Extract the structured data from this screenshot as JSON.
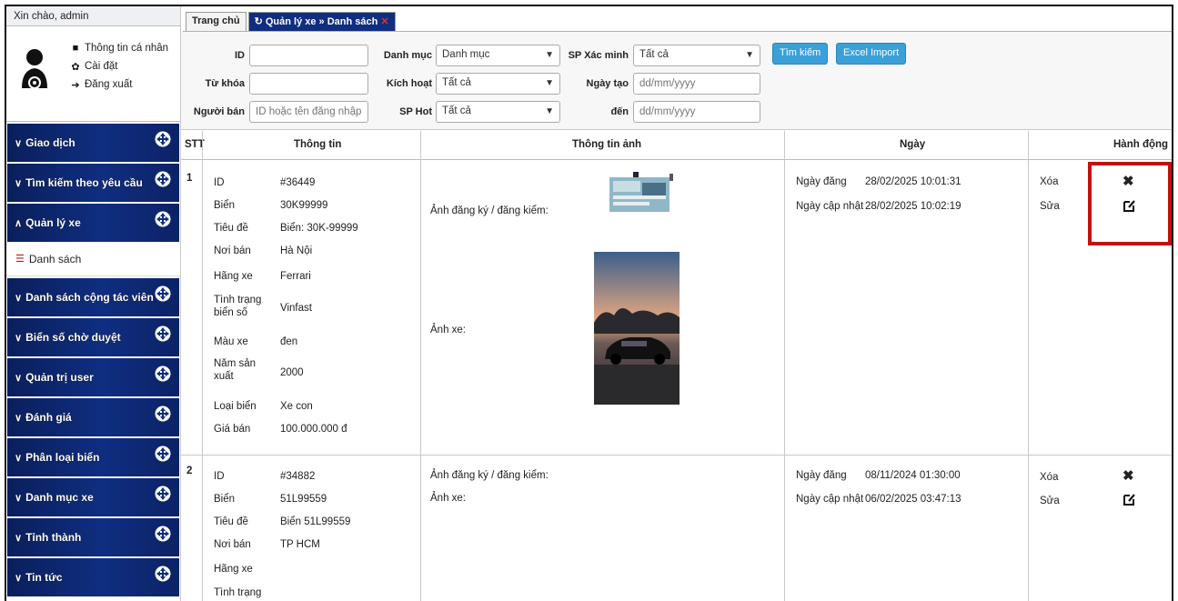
{
  "sidebar": {
    "greeting": "Xin chào, admin",
    "user_links": [
      "Thông tin cá nhân",
      "Cài đặt",
      "Đăng xuất"
    ],
    "menu": [
      "Giao dịch",
      "Tìm kiếm theo yêu cầu",
      "Quản lý xe",
      "Danh sách cộng tác viên",
      "Biển số chờ duyệt",
      "Quản trị user",
      "Đánh giá",
      "Phân loại biển",
      "Danh mục xe",
      "Tỉnh thành",
      "Tin tức"
    ],
    "submenu_label": "Danh sách"
  },
  "tabs": {
    "home": "Trang chủ",
    "active": "Quản lý xe » Danh sách",
    "close": "✕"
  },
  "filter": {
    "id_label": "ID",
    "keyword_label": "Từ khóa",
    "seller_label": "Người bán",
    "seller_placeholder": "ID hoặc tên đăng nhập",
    "category_label": "Danh mục",
    "category_value": "Danh mục",
    "active_label": "Kích hoạt",
    "active_value": "Tất cả",
    "hot_label": "SP Hot",
    "hot_value": "Tất cả",
    "verified_label": "SP Xác minh",
    "verified_value": "Tất cả",
    "created_label": "Ngày tạo",
    "created_placeholder": "dd/mm/yyyy",
    "to_label": "đến",
    "to_placeholder": "dd/mm/yyyy",
    "search_button": "Tìm kiếm",
    "import_button": "Excel Import"
  },
  "table": {
    "headers": [
      "STT",
      "Thông tin",
      "Thông tin ảnh",
      "Ngày",
      "Hành động"
    ],
    "rows": [
      {
        "stt": "1",
        "info": [
          [
            "ID",
            "#36449"
          ],
          [
            "Biển",
            "30K99999"
          ],
          [
            "Tiêu đề",
            "Biển: 30K-99999"
          ],
          [
            "Nơi bán",
            "Hà Nội"
          ],
          [
            "Hãng xe",
            "Ferrari"
          ],
          [
            "Tình trạng biển số",
            "Vinfast"
          ],
          [
            "Màu xe",
            "đen"
          ],
          [
            "Năm sản xuất",
            "2000"
          ],
          [
            "Loại biển",
            "Xe con"
          ],
          [
            "Giá bán",
            "100.000.000 đ"
          ]
        ],
        "photo_reg_label": "Ảnh đăng ký / đăng kiểm:",
        "photo_car_label": "Ảnh xe:",
        "date_posted_label": "Ngày đăng",
        "date_posted": "28/02/2025 10:01:31",
        "date_updated_label": "Ngày cập nhật",
        "date_updated": "28/02/2025 10:02:19",
        "delete": "Xóa",
        "edit": "Sửa"
      },
      {
        "stt": "2",
        "info": [
          [
            "ID",
            "#34882"
          ],
          [
            "Biển",
            "51L99559"
          ],
          [
            "Tiêu đề",
            "Biển 51L99559"
          ],
          [
            "Nơi bán",
            "TP HCM"
          ],
          [
            "Hãng xe",
            ""
          ],
          [
            "Tình trạng",
            ""
          ]
        ],
        "photo_reg_label": "Ảnh đăng ký / đăng kiểm:",
        "photo_car_label": "Ảnh xe:",
        "date_posted_label": "Ngày đăng",
        "date_posted": "08/11/2024 01:30:00",
        "date_updated_label": "Ngày cập nhật",
        "date_updated": "06/02/2025 03:47:13",
        "delete": "Xóa",
        "edit": "Sửa"
      }
    ]
  },
  "colors": {
    "menu_bg": "#0f2e80",
    "button": "#3aa0d8",
    "highlight": "#c41010"
  }
}
